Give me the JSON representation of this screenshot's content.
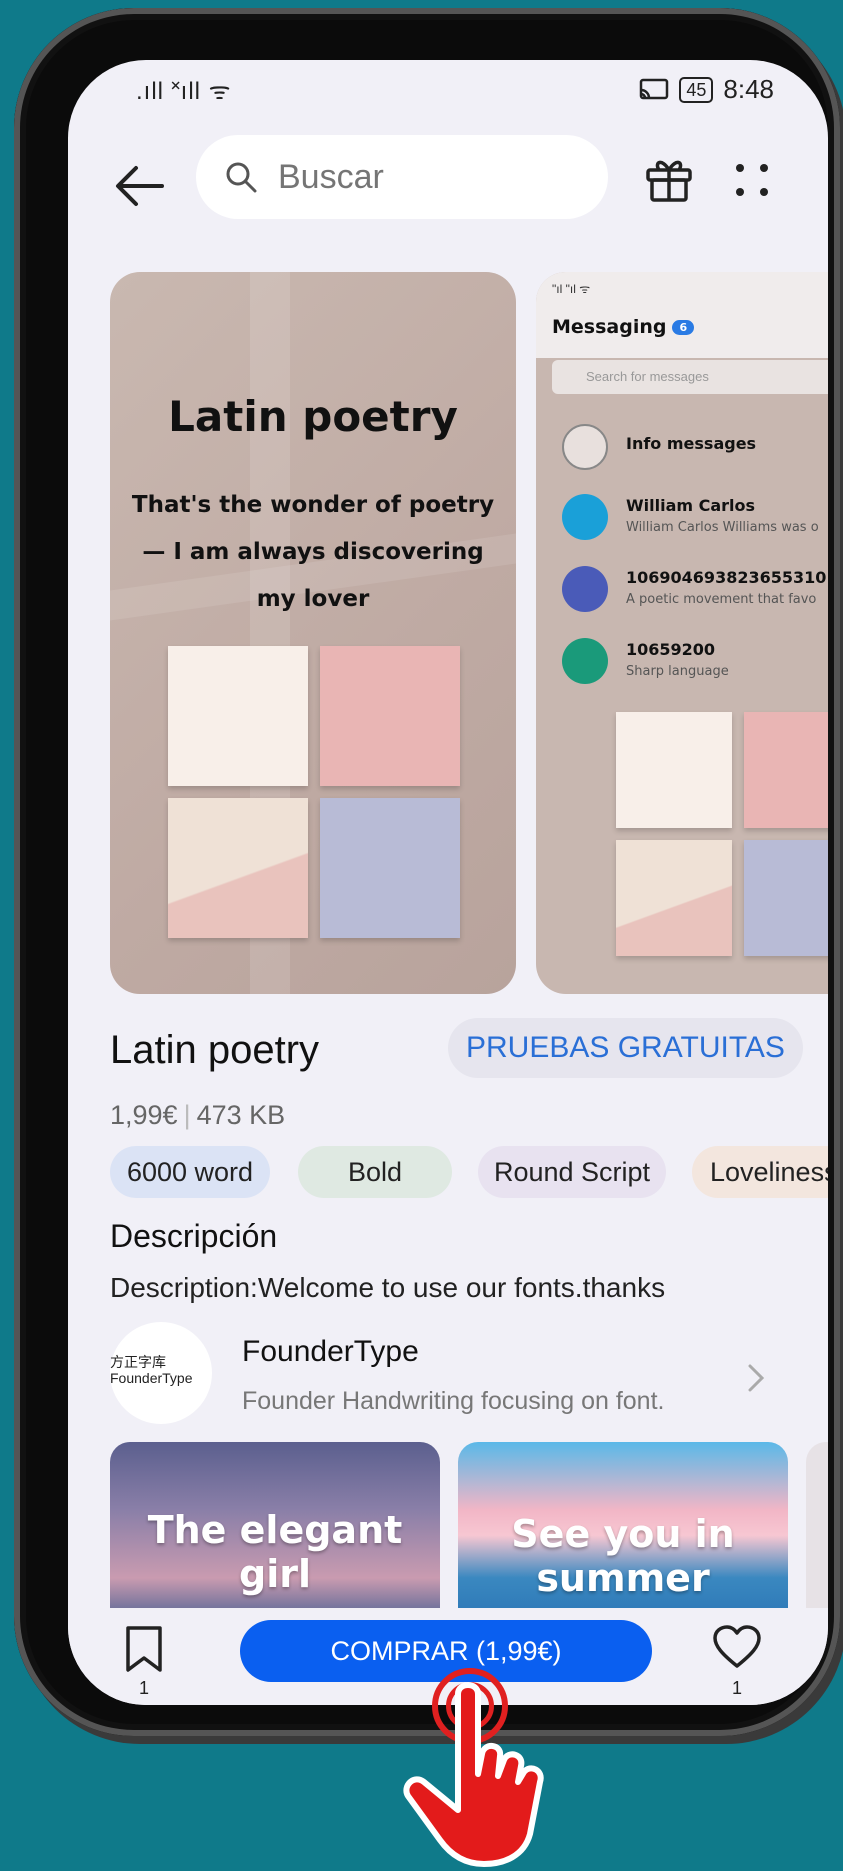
{
  "status_bar": {
    "signal": ".ıll ˟ıll ᯤ",
    "battery": "45",
    "time": "8:48"
  },
  "search": {
    "placeholder": "Buscar"
  },
  "preview_main": {
    "title": "Latin poetry",
    "body": "That's the wonder of poetry — I am always discovering my lover"
  },
  "preview_second": {
    "status": "\"ıl \"ıl ᯤ",
    "title": "Messaging",
    "badge": "6",
    "search_placeholder": "Search for messages",
    "messages": [
      {
        "name": "Info messages",
        "snippet": ""
      },
      {
        "name": "William Carlos",
        "snippet": "William Carlos Williams was o"
      },
      {
        "name": "106904693823655310",
        "snippet": "A poetic movement that favo"
      },
      {
        "name": "10659200",
        "snippet": "Sharp language"
      }
    ]
  },
  "app": {
    "name": "Latin poetry",
    "trial_label": "PRUEBAS GRATUITAS",
    "price": "1,99€",
    "size": "473 KB",
    "tags": [
      "6000 word",
      "Bold",
      "Round Script",
      "Loveliness"
    ]
  },
  "description": {
    "heading": "Descripción",
    "text": "Description:Welcome to use our fonts.thanks"
  },
  "developer": {
    "logo_text": "方正字库 FounderType",
    "name": "FounderType",
    "subtitle": "Founder Handwriting focusing on font."
  },
  "recommendations": [
    {
      "title": "The elegant girl"
    },
    {
      "title": "See you in summer"
    }
  ],
  "bottom_bar": {
    "bookmark_count": "1",
    "buy_label": "COMPRAR (1,99€)",
    "favorite_count": "1"
  },
  "colors": {
    "accent": "#0a5ff0",
    "background": "#0f7a8a",
    "trial_text": "#2a6fd6"
  }
}
